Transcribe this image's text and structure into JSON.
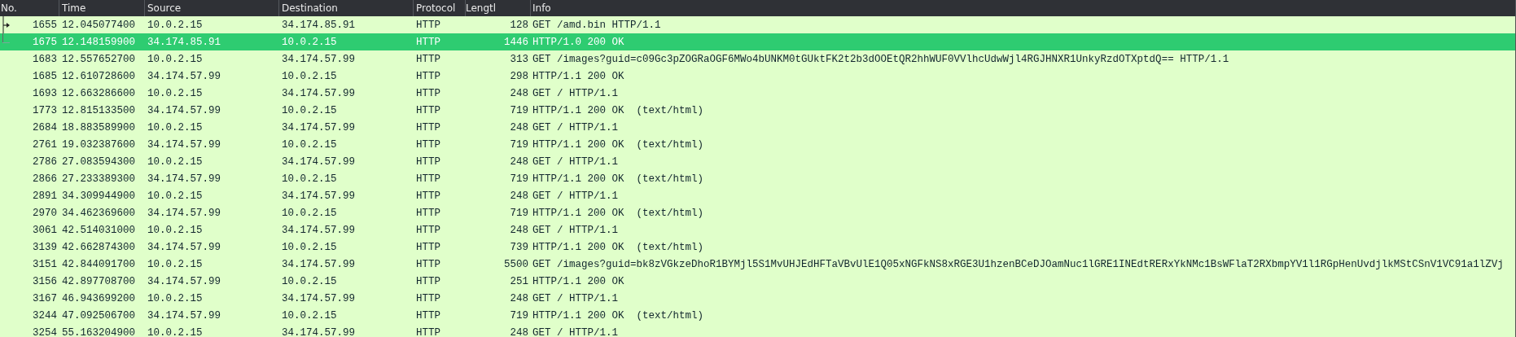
{
  "columns": [
    "No.",
    "Time",
    "Source",
    "Destination",
    "Protocol",
    "Lengtl",
    "Info"
  ],
  "rows": [
    {
      "no": "1655",
      "time": "12.045077400",
      "source": "10.0.2.15",
      "destination": "34.174.85.91",
      "protocol": "HTTP",
      "length": "128",
      "info": "GET /amd.bin HTTP/1.1",
      "selected": false,
      "kind": "request"
    },
    {
      "no": "1675",
      "time": "12.148159900",
      "source": "34.174.85.91",
      "destination": "10.0.2.15",
      "protocol": "HTTP",
      "length": "1446",
      "info": "HTTP/1.0 200 OK",
      "selected": true,
      "kind": "response"
    },
    {
      "no": "1683",
      "time": "12.557652700",
      "source": "10.0.2.15",
      "destination": "34.174.57.99",
      "protocol": "HTTP",
      "length": "313",
      "info": "GET /images?guid=c09Gc3pZOGRaOGF6MWo4bUNKM0tGUktFK2t2b3dOOEtQR2hhWUF0VVlhcUdwWjl4RGJHNXR1UnkyRzdOTXptdQ== HTTP/1.1",
      "selected": false
    },
    {
      "no": "1685",
      "time": "12.610728600",
      "source": "34.174.57.99",
      "destination": "10.0.2.15",
      "protocol": "HTTP",
      "length": "298",
      "info": "HTTP/1.1 200 OK",
      "selected": false
    },
    {
      "no": "1693",
      "time": "12.663286600",
      "source": "10.0.2.15",
      "destination": "34.174.57.99",
      "protocol": "HTTP",
      "length": "248",
      "info": "GET / HTTP/1.1",
      "selected": false
    },
    {
      "no": "1773",
      "time": "12.815133500",
      "source": "34.174.57.99",
      "destination": "10.0.2.15",
      "protocol": "HTTP",
      "length": "719",
      "info": "HTTP/1.1 200 OK  (text/html)",
      "selected": false
    },
    {
      "no": "2684",
      "time": "18.883589900",
      "source": "10.0.2.15",
      "destination": "34.174.57.99",
      "protocol": "HTTP",
      "length": "248",
      "info": "GET / HTTP/1.1",
      "selected": false
    },
    {
      "no": "2761",
      "time": "19.032387600",
      "source": "34.174.57.99",
      "destination": "10.0.2.15",
      "protocol": "HTTP",
      "length": "719",
      "info": "HTTP/1.1 200 OK  (text/html)",
      "selected": false
    },
    {
      "no": "2786",
      "time": "27.083594300",
      "source": "10.0.2.15",
      "destination": "34.174.57.99",
      "protocol": "HTTP",
      "length": "248",
      "info": "GET / HTTP/1.1",
      "selected": false
    },
    {
      "no": "2866",
      "time": "27.233389300",
      "source": "34.174.57.99",
      "destination": "10.0.2.15",
      "protocol": "HTTP",
      "length": "719",
      "info": "HTTP/1.1 200 OK  (text/html)",
      "selected": false
    },
    {
      "no": "2891",
      "time": "34.309944900",
      "source": "10.0.2.15",
      "destination": "34.174.57.99",
      "protocol": "HTTP",
      "length": "248",
      "info": "GET / HTTP/1.1",
      "selected": false
    },
    {
      "no": "2970",
      "time": "34.462369600",
      "source": "34.174.57.99",
      "destination": "10.0.2.15",
      "protocol": "HTTP",
      "length": "719",
      "info": "HTTP/1.1 200 OK  (text/html)",
      "selected": false
    },
    {
      "no": "3061",
      "time": "42.514031000",
      "source": "10.0.2.15",
      "destination": "34.174.57.99",
      "protocol": "HTTP",
      "length": "248",
      "info": "GET / HTTP/1.1",
      "selected": false
    },
    {
      "no": "3139",
      "time": "42.662874300",
      "source": "34.174.57.99",
      "destination": "10.0.2.15",
      "protocol": "HTTP",
      "length": "739",
      "info": "HTTP/1.1 200 OK  (text/html)",
      "selected": false
    },
    {
      "no": "3151",
      "time": "42.844091700",
      "source": "10.0.2.15",
      "destination": "34.174.57.99",
      "protocol": "HTTP",
      "length": "5500",
      "info": "GET /images?guid=bk8zVGkzeDhoR1BYMjl5S1MvUHJEdHFTaVBvUlE1Q05xNGFkNS8xRGE3U1hzenBCeDJOamNuc1lGRE1INEdtRERxYkNMc1BsWFlaT2RXbmpYV1l1RGpHenUvdjlkMStCSnV1VC91a1lZVj",
      "selected": false
    },
    {
      "no": "3156",
      "time": "42.897708700",
      "source": "34.174.57.99",
      "destination": "10.0.2.15",
      "protocol": "HTTP",
      "length": "251",
      "info": "HTTP/1.1 200 OK",
      "selected": false
    },
    {
      "no": "3167",
      "time": "46.943699200",
      "source": "10.0.2.15",
      "destination": "34.174.57.99",
      "protocol": "HTTP",
      "length": "248",
      "info": "GET / HTTP/1.1",
      "selected": false
    },
    {
      "no": "3244",
      "time": "47.092506700",
      "source": "34.174.57.99",
      "destination": "10.0.2.15",
      "protocol": "HTTP",
      "length": "719",
      "info": "HTTP/1.1 200 OK  (text/html)",
      "selected": false
    },
    {
      "no": "3254",
      "time": "55.163204900",
      "source": "10.0.2.15",
      "destination": "34.174.57.99",
      "protocol": "HTTP",
      "length": "248",
      "info": "GET / HTTP/1.1",
      "selected": false
    }
  ]
}
